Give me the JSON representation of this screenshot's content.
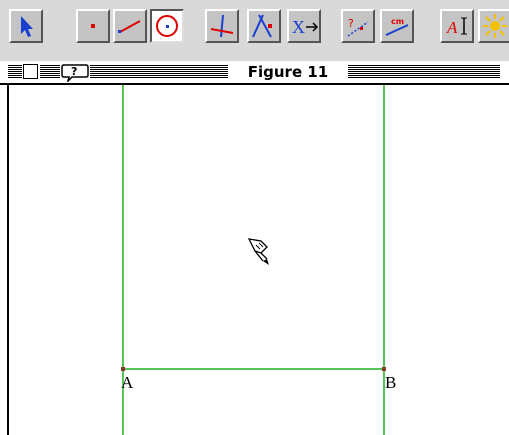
{
  "window": {
    "title": "Figure 11",
    "help_icon": "help-bubble-icon"
  },
  "toolbar": {
    "tools": [
      {
        "name": "arrow-select-tool",
        "icon": "arrow-icon",
        "selected": false
      },
      {
        "name": "point-tool",
        "icon": "point-icon",
        "selected": false
      },
      {
        "name": "segment-tool",
        "icon": "segment-icon",
        "selected": false
      },
      {
        "name": "circle-tool",
        "icon": "circle-icon",
        "selected": true
      },
      {
        "name": "perpendicular-tool",
        "icon": "perpendicular-lines-icon",
        "selected": false
      },
      {
        "name": "intersection-tool",
        "icon": "intersection-point-icon",
        "selected": false
      },
      {
        "name": "transform-tool",
        "icon": "transform-x-arrow-icon",
        "selected": false
      },
      {
        "name": "question-point-tool",
        "icon": "question-point-icon",
        "selected": false
      },
      {
        "name": "measure-tool",
        "icon": "measure-cm-icon",
        "selected": false
      },
      {
        "name": "text-tool",
        "icon": "text-a-icon",
        "selected": false
      },
      {
        "name": "display-tool",
        "icon": "sun-icon",
        "selected": false
      }
    ],
    "transform_label": "X",
    "measure_label": "cm",
    "text_label": "A"
  },
  "figure": {
    "point_a_label": "A",
    "point_b_label": "B",
    "line_color": "#1fb11f",
    "point_color": "#8a3a2a",
    "cursor": "pencil-cursor-icon"
  }
}
